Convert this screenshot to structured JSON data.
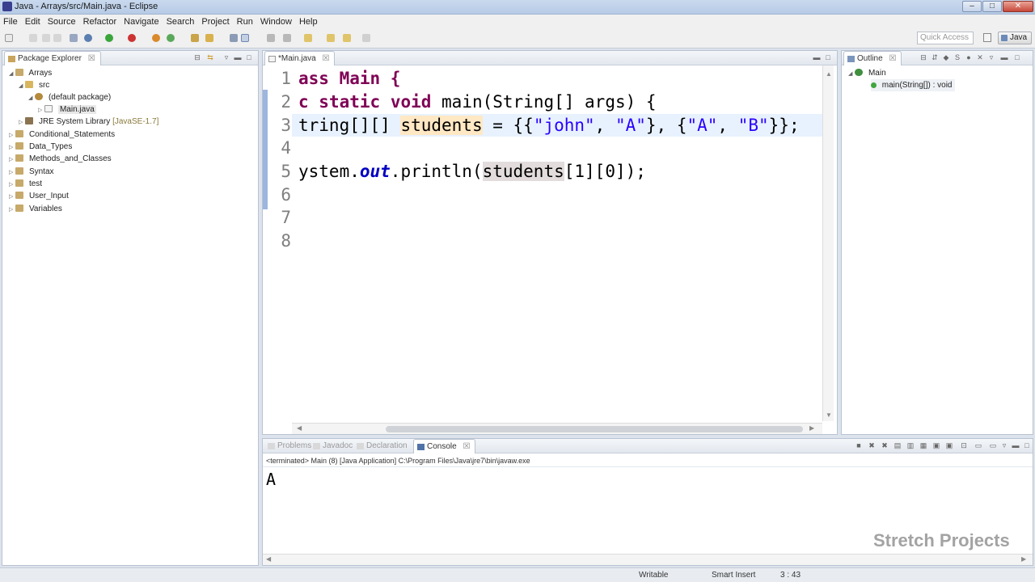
{
  "window": {
    "title": "Java - Arrays/src/Main.java - Eclipse",
    "minimize": "–",
    "maximize": "□",
    "close": "✕"
  },
  "menu": [
    "File",
    "Edit",
    "Source",
    "Refactor",
    "Navigate",
    "Search",
    "Project",
    "Run",
    "Window",
    "Help"
  ],
  "toolbar": {
    "quick_access_placeholder": "Quick Access",
    "perspective": "Java"
  },
  "package_explorer": {
    "tab_label": "Package Explorer",
    "tree": [
      {
        "label": "Arrays",
        "level": 0,
        "expanded": true,
        "icon": "project-icon"
      },
      {
        "label": "src",
        "level": 1,
        "expanded": true,
        "icon": "source-folder-icon"
      },
      {
        "label": "(default package)",
        "level": 2,
        "expanded": true,
        "icon": "package-icon"
      },
      {
        "label": "Main.java",
        "level": 3,
        "expanded": false,
        "icon": "java-file-icon"
      },
      {
        "label": "JRE System Library",
        "decor": "[JavaSE-1.7]",
        "level": 1,
        "expanded": false,
        "icon": "library-icon"
      },
      {
        "label": "Conditional_Statements",
        "level": 0,
        "expanded": false,
        "icon": "project-icon"
      },
      {
        "label": "Data_Types",
        "level": 0,
        "expanded": false,
        "icon": "project-icon"
      },
      {
        "label": "Methods_and_Classes",
        "level": 0,
        "expanded": false,
        "icon": "project-icon"
      },
      {
        "label": "Syntax",
        "level": 0,
        "expanded": false,
        "icon": "project-icon"
      },
      {
        "label": "test",
        "level": 0,
        "expanded": false,
        "icon": "project-icon"
      },
      {
        "label": "User_Input",
        "level": 0,
        "expanded": false,
        "icon": "project-icon"
      },
      {
        "label": "Variables",
        "level": 0,
        "expanded": false,
        "icon": "project-icon"
      }
    ]
  },
  "editor": {
    "tab_label": "*Main.java",
    "line_numbers": [
      "1",
      "2",
      "3",
      "4",
      "5",
      "6",
      "7",
      "8"
    ],
    "code": {
      "line1_a": "ass Main {",
      "line2_kw1": "c ",
      "line2_kw2": "static",
      "line2_kw3": "void",
      "line2_rest": " main(String[] args) {",
      "line3_a": "tring[][] ",
      "line3_var": "students",
      "line3_b": " = {{",
      "line3_s1": "\"john\"",
      "line3_c": ", ",
      "line3_s2": "\"A\"",
      "line3_d": "}, {",
      "line3_s3": "\"A\"",
      "line3_e": ", ",
      "line3_s4": "\"B\"",
      "line3_f": "}};",
      "line5_a": "ystem.",
      "line5_field": "out",
      "line5_b": ".println(",
      "line5_var": "students",
      "line5_c": "[1][0]);"
    }
  },
  "outline": {
    "tab_label": "Outline",
    "items": [
      {
        "label": "Main",
        "level": 0
      },
      {
        "label": "main(String[]) : void",
        "level": 1
      }
    ]
  },
  "bottom_panel": {
    "tabs": [
      "Problems",
      "Javadoc",
      "Declaration",
      "Console"
    ],
    "active_tab": "Console",
    "console_path": "<terminated> Main (8) [Java Application] C:\\Program Files\\Java\\jre7\\bin\\javaw.exe",
    "console_output": "A"
  },
  "status_bar": {
    "writable": "Writable",
    "insert_mode": "Smart Insert",
    "position": "3 : 43"
  },
  "watermark": "Stretch Projects",
  "colors": {
    "keyword": "#7f0055",
    "string": "#2a00ff",
    "field": "#0000c0",
    "current_line": "#e8f2fe"
  }
}
